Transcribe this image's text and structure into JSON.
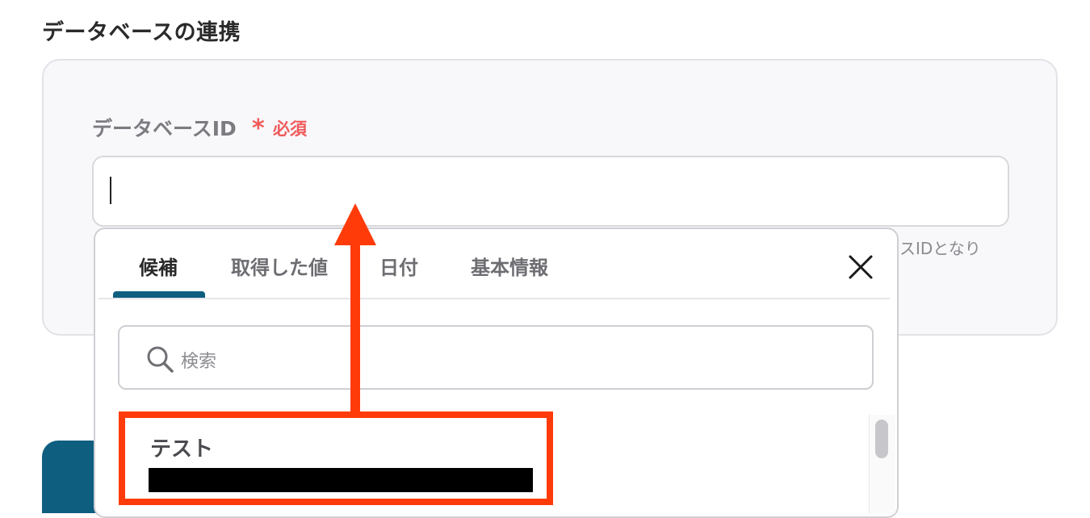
{
  "section": {
    "title": "データベースの連携"
  },
  "field": {
    "label": "データベースID",
    "required_mark": "*",
    "required_text": "必須",
    "value": "",
    "help_text_partial": "ースIDとなり"
  },
  "popover": {
    "tabs": [
      {
        "label": "候補",
        "active": true
      },
      {
        "label": "取得した値",
        "active": false
      },
      {
        "label": "日付",
        "active": false
      },
      {
        "label": "基本情報",
        "active": false
      }
    ],
    "close_icon": "close-icon",
    "search": {
      "placeholder": "検索",
      "icon": "search-icon"
    },
    "items": [
      {
        "title": "テスト",
        "subtitle_redacted": true
      }
    ]
  },
  "colors": {
    "accent": "#0e5e80",
    "required": "#f05a5a",
    "annotation": "#ff3b0a",
    "panel_bg": "#f8f7fa"
  }
}
